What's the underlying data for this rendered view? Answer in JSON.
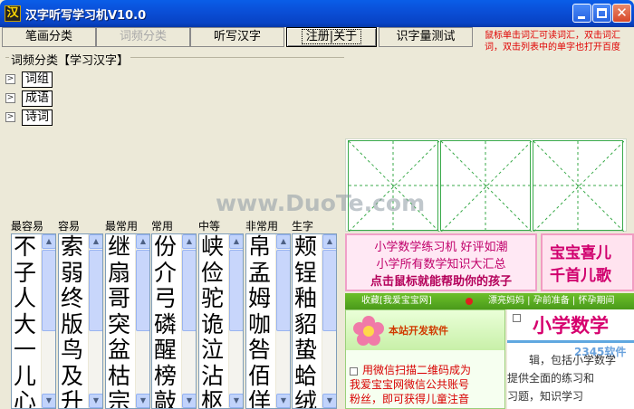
{
  "window": {
    "title": "汉字听写学习机V10.0",
    "icon_char": "汉"
  },
  "toolbar": {
    "buttons": [
      {
        "label": "笔画分类"
      },
      {
        "label": "词频分类"
      },
      {
        "label": "听写汉字"
      },
      {
        "label": "注册|关于"
      },
      {
        "label": "识字量测试"
      }
    ],
    "hint_line1": "鼠标单击词汇可读词汇，双击词汇",
    "hint_line2": "词，双击列表中的单字也打开百度"
  },
  "group": {
    "title": "词频分类【学习汉字】"
  },
  "tree": [
    {
      "expander": ">",
      "label": "词组"
    },
    {
      "expander": ">",
      "label": "成语"
    },
    {
      "expander": ">",
      "label": "诗词"
    }
  ],
  "watermark": "www.DuoTe.com",
  "lists": [
    {
      "header": "最容易",
      "chars": [
        "不",
        "子",
        "人",
        "大",
        "一",
        "儿",
        "心"
      ]
    },
    {
      "header": "容易",
      "chars": [
        "索",
        "弱",
        "终",
        "版",
        "鸟",
        "及",
        "升"
      ]
    },
    {
      "header": "最常用",
      "chars": [
        "继",
        "扇",
        "哥",
        "突",
        "盆",
        "枯",
        "宗"
      ]
    },
    {
      "header": "常用",
      "chars": [
        "份",
        "介",
        "弓",
        "磷",
        "醒",
        "榜",
        "敲"
      ]
    },
    {
      "header": "中等",
      "chars": [
        "峡",
        "俭",
        "驼",
        "诡",
        "泣",
        "沾",
        "枢"
      ]
    },
    {
      "header": "非常用",
      "chars": [
        "帛",
        "孟",
        "姆",
        "咖",
        "咎",
        "佰",
        "佯"
      ]
    },
    {
      "header": "生字",
      "chars": [
        "颊",
        "锃",
        "釉",
        "貂",
        "蛰",
        "蛤",
        "绒"
      ]
    }
  ],
  "ads": {
    "top_line1": "小学数学练习机  好评如潮",
    "top_line2": "小学所有数学知识大汇总",
    "top_line3": "点击鼠标就能帮助你的孩子",
    "right_line1": "宝宝喜儿",
    "right_line2": "千首儿歌",
    "nav_left": "收藏[我爱宝宝网]",
    "nav_right": "漂亮妈妈 | 孕前准备 | 怀孕期间",
    "soft_label": "本站开发软件",
    "msg_line1": "用微信扫描二维码成为",
    "msg_line2": "我爱宝宝网微信公共账号",
    "msg_line3": "粉丝，即可获得儿童注音",
    "main_title": "小学数学",
    "main_line1": "辑，包括小学数学",
    "main_line2": "提供全面的练习和",
    "main_line3": "习题，知识学习",
    "logo": "2345软件"
  },
  "colors": {
    "titlebar": "#0a4fd8",
    "hint_red": "#e00000",
    "grid_green": "#3aaa4a",
    "ad_pink": "#d6006e"
  },
  "icons": [
    "app-icon",
    "minimize-icon",
    "maximize-icon",
    "close-icon",
    "scroll-up-icon",
    "scroll-down-icon",
    "flower-icon"
  ]
}
